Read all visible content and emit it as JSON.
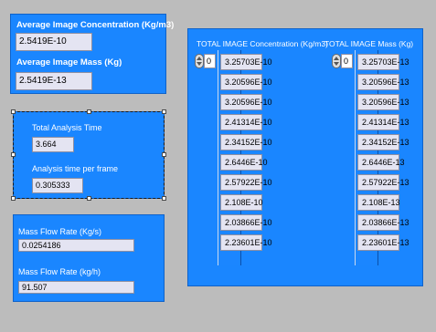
{
  "average_panel": {
    "concentration_label": "Average Image Concentration  (Kg/m3)",
    "concentration_value": "2.5419E-10",
    "mass_label": "Average Image Mass (Kg)",
    "mass_value": "2.5419E-13"
  },
  "time_panel": {
    "total_label": "Total Analysis Time",
    "total_value": "3.664",
    "per_frame_label": "Analysis time per frame",
    "per_frame_value": "0.305333"
  },
  "flow_panel": {
    "kgs_label": "Mass Flow Rate (Kg/s)",
    "kgs_value": "0.0254186",
    "kgh_label": "Mass Flow Rate (kg/h)",
    "kgh_value": "91.507"
  },
  "arrays_panel": {
    "concentration": {
      "label": "TOTAL IMAGE Concentration (Kg/m3)",
      "index": "0",
      "values": [
        "3.25703E-10",
        "3.20596E-10",
        "3.20596E-10",
        "2.41314E-10",
        "2.34152E-10",
        "2.6446E-10",
        "2.57922E-10",
        "2.108E-10",
        "2.03866E-10",
        "2.23601E-10"
      ]
    },
    "mass": {
      "label": "TOTAL IMAGE Mass (Kg)",
      "index": "0",
      "values": [
        "3.25703E-13",
        "3.20596E-13",
        "3.20596E-13",
        "2.41314E-13",
        "2.34152E-13",
        "2.6446E-13",
        "2.57922E-13",
        "2.108E-13",
        "2.03866E-13",
        "2.23601E-13"
      ]
    }
  },
  "colors": {
    "panel": "#1a86ff",
    "background": "#bcbcbc",
    "field": "#e4e4f2"
  }
}
